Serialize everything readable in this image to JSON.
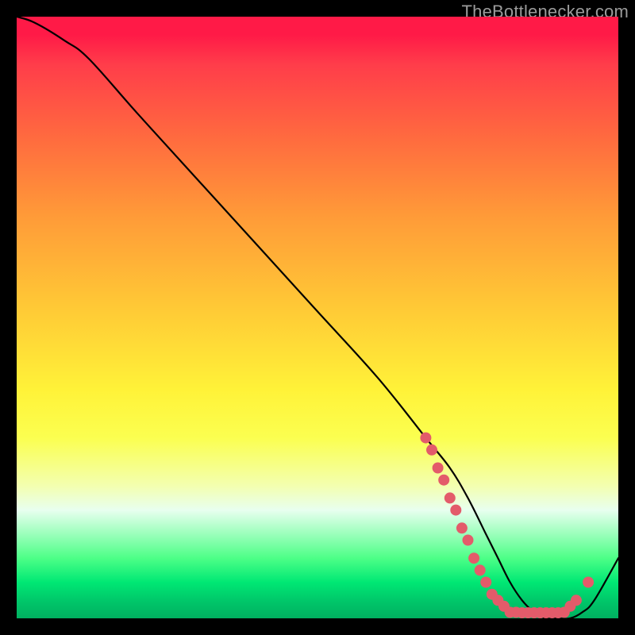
{
  "watermark": "TheBottlenecker.com",
  "chart_data": {
    "type": "line",
    "title": "",
    "xlabel": "",
    "ylabel": "",
    "xlim": [
      0,
      100
    ],
    "ylim": [
      0,
      100
    ],
    "x": [
      0,
      3,
      8,
      12,
      20,
      30,
      40,
      50,
      60,
      68,
      72,
      75,
      78,
      80,
      82,
      84,
      86,
      88,
      90,
      92,
      94,
      96,
      100
    ],
    "values": [
      100,
      99,
      96,
      93,
      84,
      73,
      62,
      51,
      40,
      30,
      25,
      20,
      14,
      10,
      6,
      3,
      1,
      0,
      0,
      0,
      1,
      3,
      10
    ],
    "markers": {
      "x": [
        68,
        69,
        70,
        71,
        72,
        73,
        74,
        75,
        76,
        77,
        78,
        79,
        80,
        81,
        82,
        83,
        84,
        85,
        86,
        87,
        88,
        89,
        90,
        91,
        92,
        93,
        95
      ],
      "values": [
        30,
        28,
        25,
        23,
        20,
        18,
        15,
        13,
        10,
        8,
        6,
        4,
        3,
        2,
        1,
        1,
        0,
        0,
        0,
        0,
        0,
        0,
        0,
        1,
        2,
        3,
        6
      ],
      "color": "#e35b6a"
    },
    "line_color": "#000000",
    "gradient_top": "#ff1a47",
    "gradient_bottom": "#00b060"
  }
}
